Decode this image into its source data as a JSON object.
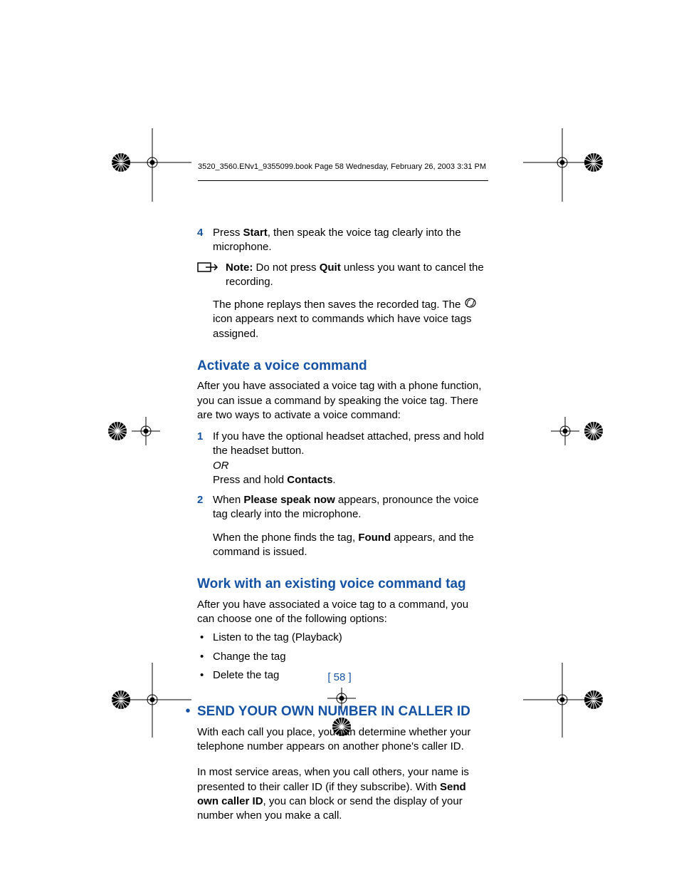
{
  "header": "3520_3560.ENv1_9355099.book  Page 58  Wednesday, February 26, 2003  3:31 PM",
  "step4": {
    "num": "4",
    "text_a": "Press ",
    "bold_a": "Start",
    "text_b": ", then speak the voice tag clearly into the microphone."
  },
  "note": {
    "label": "Note:",
    "text_a": "  Do not press ",
    "bold_a": "Quit",
    "text_b": " unless you want to cancel the recording."
  },
  "replay_para_a": "The phone replays then saves the recorded tag. The ",
  "replay_para_b": " icon appears next to commands which have voice tags assigned.",
  "heading1": "Activate a voice command",
  "para1": "After you have associated a voice tag with a phone function, you can issue a command by speaking the voice tag. There are two ways to activate a voice command:",
  "step1": {
    "num": "1",
    "line1": "If you have the optional headset attached, press and hold the headset button.",
    "or": "OR",
    "line2_a": "Press and hold ",
    "bold": "Contacts",
    "line2_b": "."
  },
  "step2": {
    "num": "2",
    "line1_a": "When ",
    "bold1": "Please speak now",
    "line1_b": " appears, pronounce the voice tag clearly into the microphone.",
    "line2_a": "When the phone finds the tag, ",
    "bold2": "Found",
    "line2_b": " appears, and the command is issued."
  },
  "heading2": "Work with an existing voice command tag",
  "para2": "After you have associated a voice tag to a command, you can choose one of the following options:",
  "bullets": [
    "Listen to the tag (Playback)",
    "Change the tag",
    "Delete the tag"
  ],
  "major_heading": "SEND YOUR OWN NUMBER IN CALLER ID",
  "major_para1": "With each call you place, you can determine whether your telephone number appears on another phone's caller ID.",
  "major_para2_a": "In most service areas, when you call others, your name is presented to their caller ID (if they subscribe). With ",
  "major_bold": "Send own caller ID",
  "major_para2_b": ", you can block or send the display of your number when you make a call.",
  "pagenum": "[ 58 ]"
}
